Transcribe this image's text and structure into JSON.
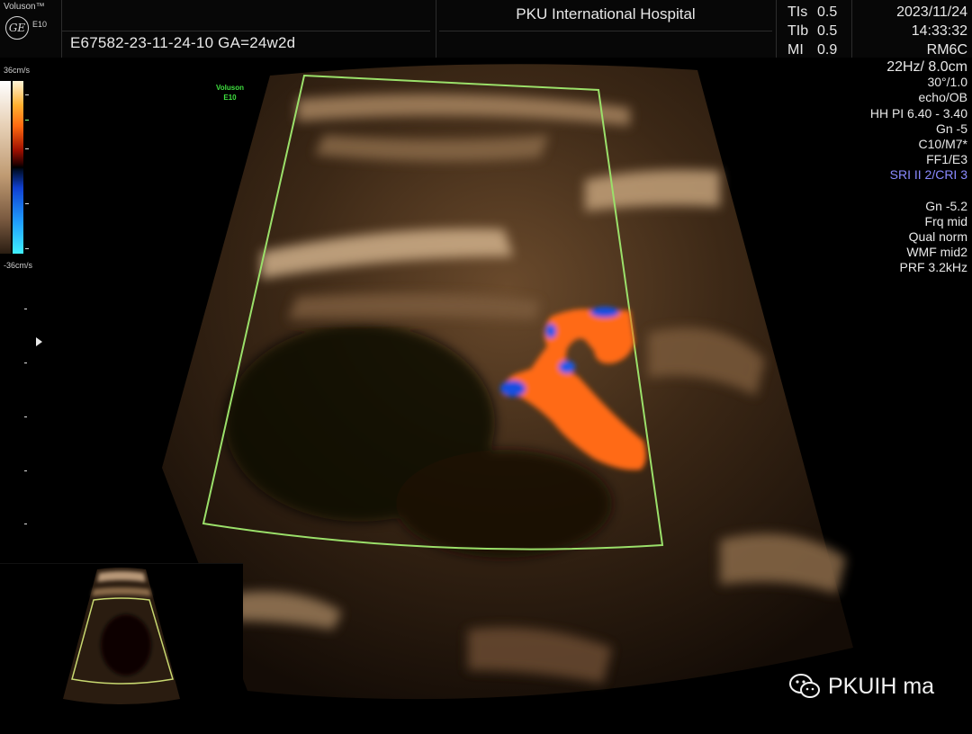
{
  "header": {
    "brand": "Voluson™",
    "logo": "GE",
    "model": "E10",
    "patient_line": "E67582-23-11-24-10  GA=24w2d",
    "hospital": "PKU International Hospital",
    "indices": [
      {
        "label": "TIs",
        "value": "0.5"
      },
      {
        "label": "TIb",
        "value": "0.5"
      },
      {
        "label": "MI",
        "value": "0.9"
      }
    ],
    "date": "2023/11/24",
    "time": "14:33:32",
    "probe": "RM6C"
  },
  "params": {
    "frame_depth": "22Hz/ 8.0cm",
    "angle": "30°/1.0",
    "preset": "echo/OB",
    "harmonic": "HH PI 6.40 - 3.40",
    "gain": "Gn  -5",
    "map": "C10/M7*",
    "filter": "FF1/E3",
    "sri": "SRI II 2/CRI 3",
    "color_gain": "Gn -5.2",
    "frequency": "Frq mid",
    "quality": "Qual norm",
    "wall_filter": "WMF mid2",
    "prf": "PRF  3.2kHz"
  },
  "color_scale": {
    "top": "36cm/s",
    "bottom": "-36cm/s",
    "colors": {
      "positive": "#ff6a10",
      "negative": "#1040d0"
    }
  },
  "roi_label": {
    "line1": "Voluson",
    "line2": "E10"
  },
  "watermark": {
    "text": "PKUIH ma",
    "icon": "wechat-icon"
  }
}
